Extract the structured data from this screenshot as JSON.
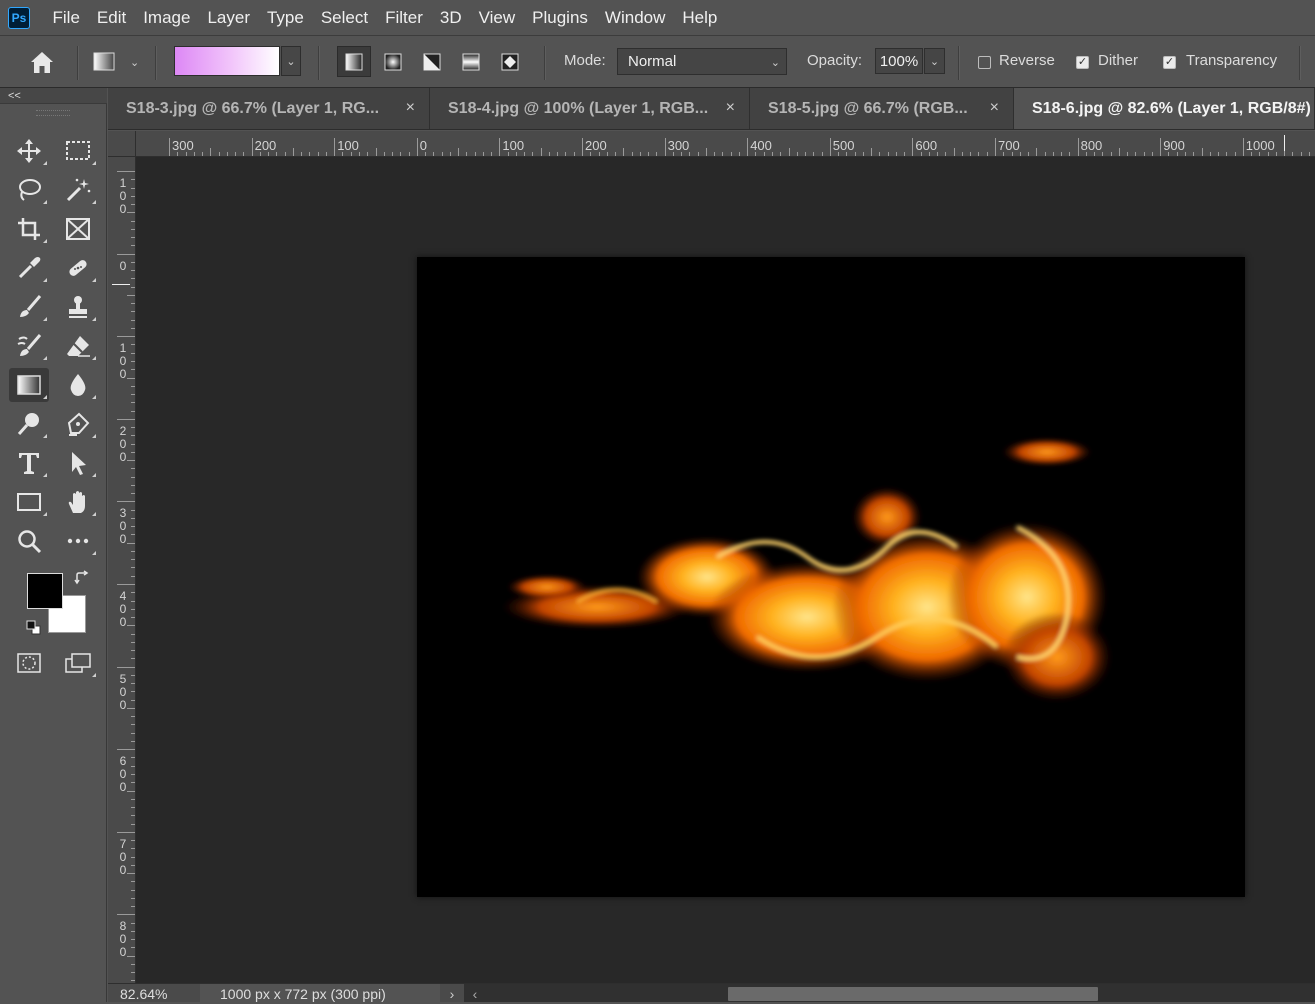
{
  "app": {
    "logo_text": "Ps"
  },
  "menu": [
    "File",
    "Edit",
    "Image",
    "Layer",
    "Type",
    "Select",
    "Filter",
    "3D",
    "View",
    "Plugins",
    "Window",
    "Help"
  ],
  "options_bar": {
    "mode_label": "Mode:",
    "mode_value": "Normal",
    "opacity_label": "Opacity:",
    "opacity_value": "100%",
    "reverse_label": "Reverse",
    "reverse_checked": false,
    "dither_label": "Dither",
    "dither_checked": true,
    "transparency_label": "Transparency",
    "transparency_checked": true,
    "gradient_colors": [
      "#dd88f5",
      "#ffffff"
    ],
    "gradient_types": [
      "linear",
      "radial",
      "angle",
      "reflected",
      "diamond"
    ],
    "active_gradient_type": "linear"
  },
  "tools_panel": {
    "collapse_label": "<<"
  },
  "tools": [
    "move-tool",
    "marquee-tool",
    "lasso-tool",
    "magic-wand-tool",
    "crop-tool",
    "frame-tool",
    "eyedropper-tool",
    "healing-brush-tool",
    "brush-tool",
    "clone-stamp-tool",
    "history-brush-tool",
    "eraser-tool",
    "gradient-tool",
    "blur-tool",
    "dodge-tool",
    "pen-tool",
    "type-tool",
    "path-selection-tool",
    "rectangle-tool",
    "hand-tool",
    "zoom-tool",
    "more-tools",
    "quick-mask-button",
    "screen-mode-button"
  ],
  "active_tool": "gradient-tool",
  "colors": {
    "foreground": "#000000",
    "background": "#ffffff"
  },
  "tabs": [
    {
      "title": "S18-3.jpg @ 66.7% (Layer 1, RG...",
      "close": "×",
      "active": false
    },
    {
      "title": "S18-4.jpg @ 100% (Layer 1, RGB...",
      "close": "×",
      "active": false
    },
    {
      "title": "S18-5.jpg @ 66.7% (RGB...",
      "close": "×",
      "active": false
    },
    {
      "title": "S18-6.jpg @ 82.6% (Layer 1, RGB/8#)",
      "close": "",
      "active": true
    }
  ],
  "ruler_h_labels": [
    "300",
    "200",
    "100",
    "0",
    "100",
    "200",
    "300",
    "400",
    "500",
    "600",
    "700",
    "800",
    "900",
    "1000"
  ],
  "ruler_v_labels": [
    "100",
    "0",
    "100",
    "200",
    "300",
    "400",
    "500",
    "600",
    "700",
    "800"
  ],
  "status": {
    "zoom": "82.64%",
    "doc_info": "1000 px x 772 px (300 ppi)",
    "menu_arrow": "›",
    "scroll_left": "‹"
  }
}
